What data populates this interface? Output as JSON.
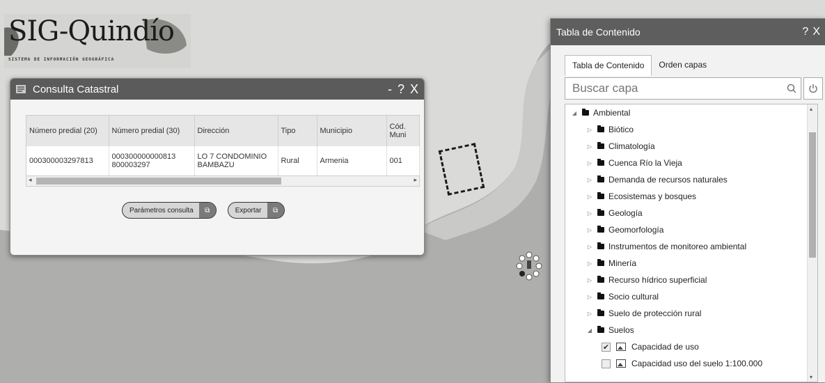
{
  "logo": {
    "title": "SIG-Quindío",
    "subtitle": "SISTEMA DE INFORMACIÓN GEOGRÁFICA"
  },
  "consulta": {
    "title": "Consulta Catastral",
    "controls": {
      "minimize": "-",
      "help": "?",
      "close": "X"
    },
    "columns": [
      "Número predial (20)",
      "Número predial (30)",
      "Dirección",
      "Tipo",
      "Municipio",
      "Cód. Muni"
    ],
    "rows": [
      [
        "000300003297813",
        "000300000000813 800003297",
        "LO 7 CONDOMINIO BAMBAZU",
        "Rural",
        "Armenia",
        "001"
      ]
    ],
    "buttons": {
      "params": "Parámetros consulta",
      "export": "Exportar"
    }
  },
  "toc": {
    "title": "Tabla de Contenido",
    "controls": {
      "help": "?",
      "close": "X"
    },
    "tabs": [
      "Tabla de Contenido",
      "Orden capas"
    ],
    "search_placeholder": "Buscar capa",
    "tree": {
      "root": "Ambiental",
      "groups": [
        "Biótico",
        "Climatología",
        "Cuenca Río la Vieja",
        "Demanda de recursos naturales",
        "Ecosistemas y bosques",
        "Geología",
        "Geomorfología",
        "Instrumentos de monitoreo ambiental",
        "Minería",
        "Recurso hídrico superficial",
        "Socio cultural",
        "Suelo de protección rural",
        "Suelos"
      ],
      "layers": [
        {
          "label": "Capacidad de uso",
          "checked": true
        },
        {
          "label": "Capacidad uso del suelo 1:100.000",
          "checked": false
        }
      ]
    }
  },
  "colors": {
    "map_bg": "#d8d8d6",
    "region": "#a9a9a9",
    "titlebar": "#5b5b5b"
  }
}
